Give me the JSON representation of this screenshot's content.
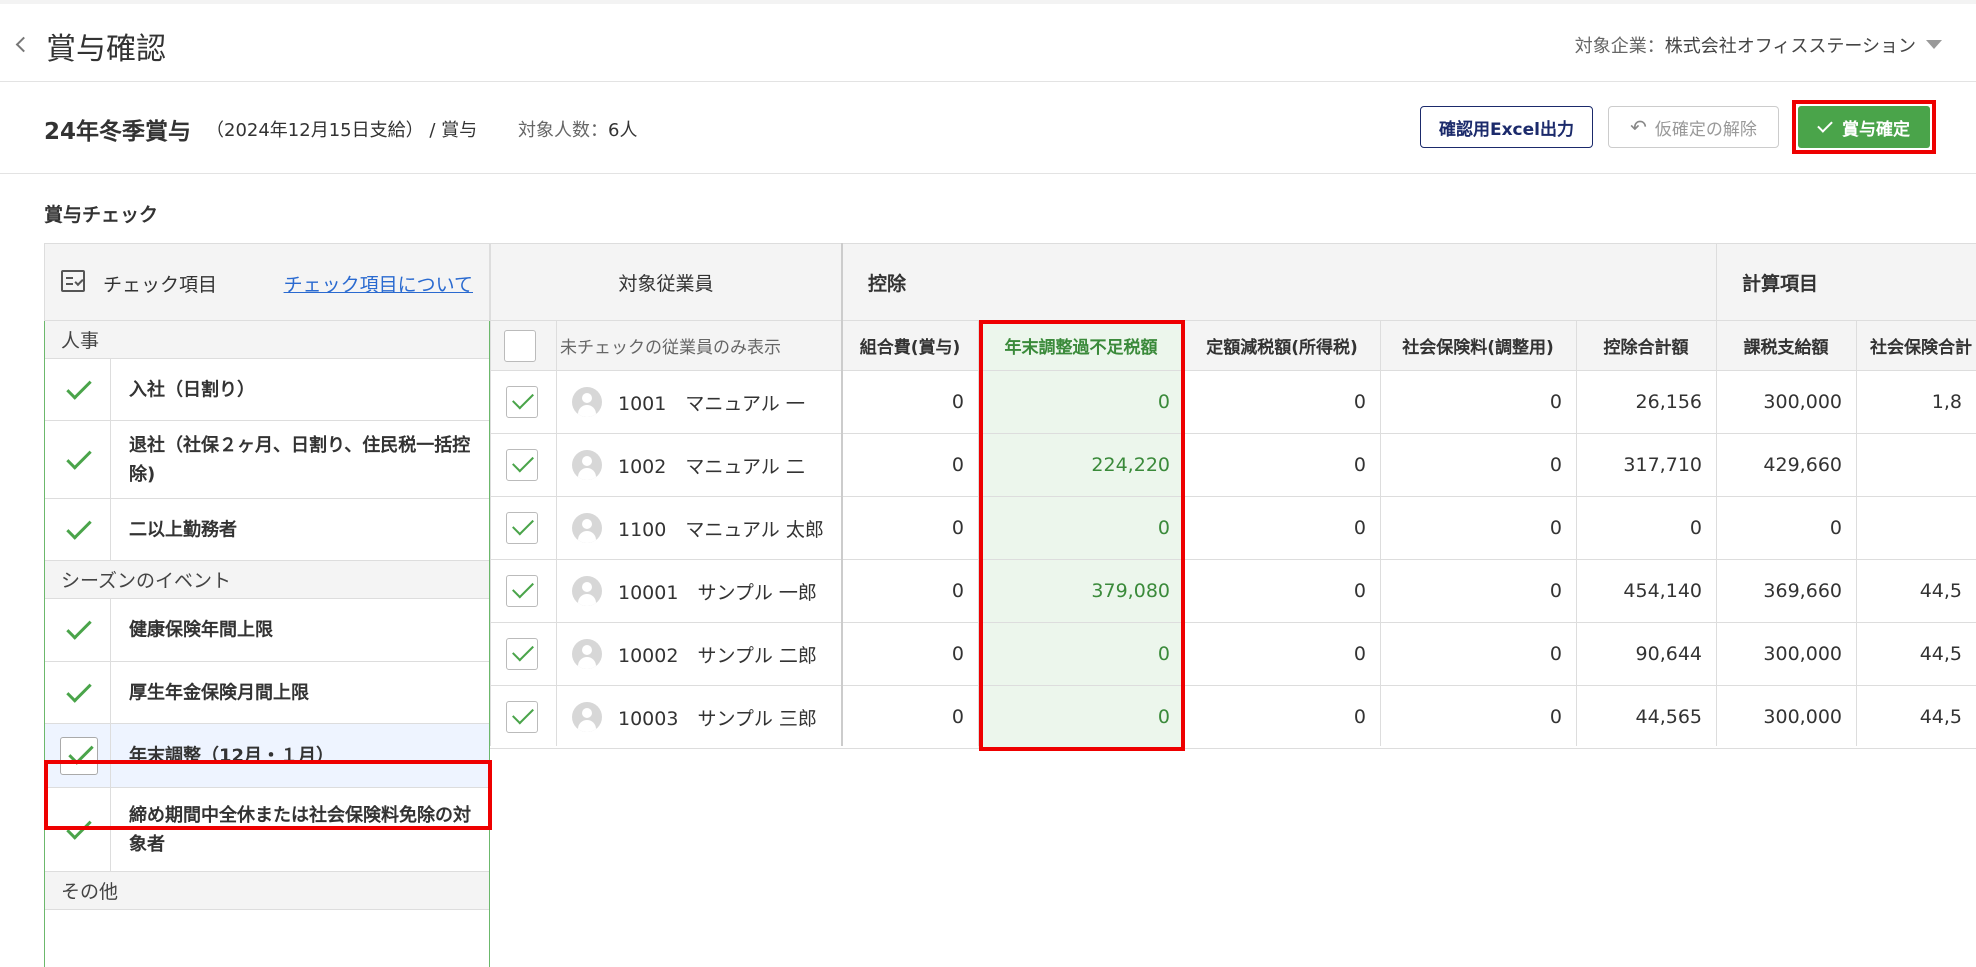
{
  "header": {
    "title": "賞与確認",
    "company_label": "対象企業：",
    "company_name": "株式会社オフィスステーション"
  },
  "bonus": {
    "name": "24年冬季賞与",
    "meta": "（2024年12月15日支給） / 賞与",
    "headcount_label": "対象人数：",
    "headcount_value": "6人"
  },
  "actions": {
    "excel": "確認用Excel出力",
    "release": "仮確定の解除",
    "confirm": "賞与確定"
  },
  "section_title": "賞与チェック",
  "checklist": {
    "header_label": "チェック項目",
    "about_link": "チェック項目について",
    "categories": [
      "人事",
      "シーズンのイベント",
      "その他"
    ],
    "items": [
      "入社（日割り）",
      "退社（社保２ヶ月、日割り、住民税一括控除)",
      "二以上勤務者",
      "健康保険年間上限",
      "厚生年金保険月間上限",
      "年末調整（12月・１月）",
      "締め期間中全休または社会保険料免除の対象者"
    ]
  },
  "table": {
    "group_headers": {
      "employee": "対象従業員",
      "deduction": "控除",
      "calc": "計算項目"
    },
    "filter_label": "未チェックの従業員のみ表示",
    "columns": [
      "組合費(賞与)",
      "年末調整過不足税額",
      "定額減税額(所得税)",
      "社会保険料(調整用)",
      "控除合計額",
      "課税支給額",
      "社会保険合計"
    ],
    "rows": [
      {
        "employee": "1001　マニュアル 一",
        "values": [
          "0",
          "0",
          "0",
          "0",
          "26,156",
          "300,000",
          "1,8"
        ]
      },
      {
        "employee": "1002　マニュアル 二",
        "values": [
          "0",
          "224,220",
          "0",
          "0",
          "317,710",
          "429,660",
          ""
        ]
      },
      {
        "employee": "1100　マニュアル 太郎",
        "values": [
          "0",
          "0",
          "0",
          "0",
          "0",
          "0",
          ""
        ]
      },
      {
        "employee": "10001　サンプル 一郎",
        "values": [
          "0",
          "379,080",
          "0",
          "0",
          "454,140",
          "369,660",
          "44,5"
        ]
      },
      {
        "employee": "10002　サンプル 二郎",
        "values": [
          "0",
          "0",
          "0",
          "0",
          "90,644",
          "300,000",
          "44,5"
        ]
      },
      {
        "employee": "10003　サンプル 三郎",
        "values": [
          "0",
          "0",
          "0",
          "0",
          "44,565",
          "300,000",
          "44,5"
        ]
      }
    ]
  },
  "colors": {
    "accent_green": "#4aa44a",
    "highlight_red": "#e00000",
    "navy": "#1b2a6b"
  }
}
